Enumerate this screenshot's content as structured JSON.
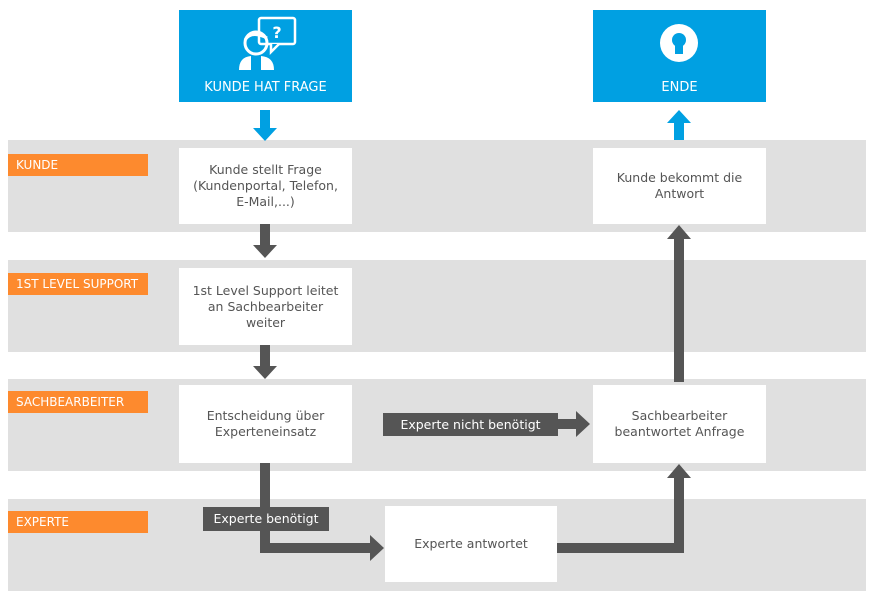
{
  "colors": {
    "accent_blue": "#00a0e2",
    "lane_label_orange": "#fd8a2e",
    "lane_bg": "#e0e0e0",
    "arrow_dark": "#555555"
  },
  "start": {
    "label": "KUNDE HAT FRAGE",
    "icon": "customer-question-icon"
  },
  "end": {
    "label": "ENDE",
    "icon": "lightbulb-icon"
  },
  "lanes": [
    {
      "label": "KUNDE"
    },
    {
      "label": "1ST LEVEL SUPPORT"
    },
    {
      "label": "SACHBEARBEITER"
    },
    {
      "label": "EXPERTE"
    }
  ],
  "steps": {
    "customer_asks": "Kunde stellt Frage (Kundenportal, Telefon, E-Mail,...)",
    "first_level": "1st Level Support leitet an Sachbearbeiter weiter",
    "decision": "Entscheidung über Experteneinsatz",
    "expert_answers": "Experte antwortet",
    "clerk_answers": "Sachbearbeiter beantwortet Anfrage",
    "customer_gets": "Kunde bekommt die Antwort"
  },
  "edges": {
    "expert_not_needed": "Experte nicht benötigt",
    "expert_needed": "Experte benötigt"
  }
}
